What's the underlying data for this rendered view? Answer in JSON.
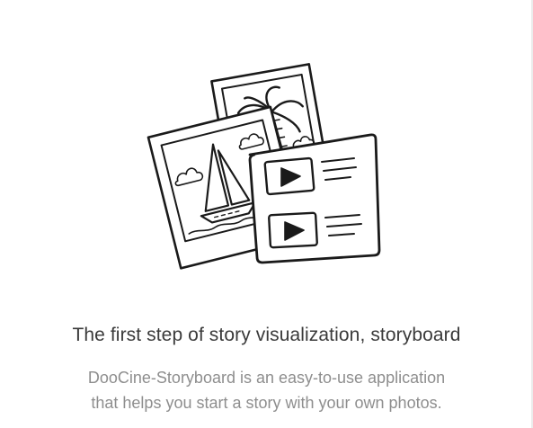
{
  "onboarding": {
    "illustration_icon": "photos-to-storyboard-illustration",
    "headline": "The first step of story visualization, storyboard",
    "description_line1": "DooCine-Storyboard is an easy-to-use application",
    "description_line2": "that helps you start a story with your own photos."
  },
  "colors": {
    "background": "#ffffff",
    "headline": "#3a3a3a",
    "description": "#8e8e8e",
    "line_art": "#1a1a1a"
  }
}
